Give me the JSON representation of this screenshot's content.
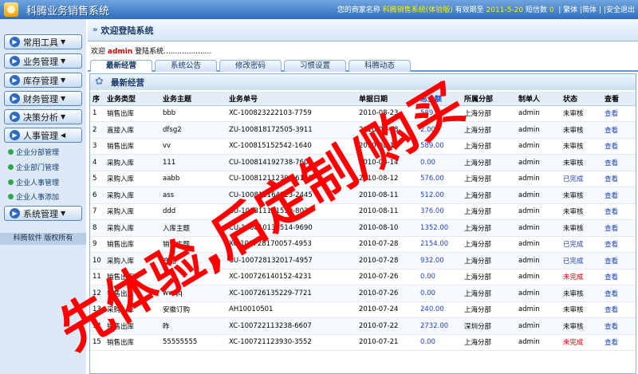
{
  "app": {
    "title": "科腾业务销售系统"
  },
  "topbar": {
    "shop_label": "您的商家名称",
    "shop_name": "科腾销售系统(体验版)",
    "valid_label": "有效期至",
    "valid_date": "2011-5-20",
    "sms_label": "短信数",
    "sms_count": "0",
    "links": [
      "繁体",
      "简体",
      "安全退出"
    ]
  },
  "sidebar": {
    "menus": [
      "常用工具",
      "业务管理",
      "库存管理",
      "财务管理",
      "决策分析",
      "人事管理",
      "系统管理"
    ],
    "hr_items": [
      "企业分部管理",
      "企业部门管理",
      "企业人事管理",
      "企业人事添加"
    ],
    "footer": "科腾软件 版权所有"
  },
  "main": {
    "header": "欢迎登陆系统",
    "welcome_prefix": "欢迎",
    "user": "admin",
    "welcome_suffix": "登陆系统.....................",
    "tabs": [
      "最新经营",
      "系统公告",
      "修改密码",
      "习惯设置",
      "科腾动态"
    ],
    "panel_title": "最新经营"
  },
  "table": {
    "columns": [
      "序",
      "业务类型",
      "业务主题",
      "业务单号",
      "单据日期",
      "总金额",
      "所属分部",
      "制单人",
      "状态",
      "查看"
    ],
    "rows": [
      [
        "1",
        "销售出库",
        "bbb",
        "XC-100823222103-7759",
        "2010-08-23",
        "589.00",
        "上海分部",
        "admin",
        "未审核",
        "查看"
      ],
      [
        "2",
        "直接入库",
        "dfsg2",
        "ZU-100818172505-3911",
        "2010-08-18",
        "2.00",
        "上海分部",
        "admin",
        "未审核",
        "查看"
      ],
      [
        "3",
        "销售出库",
        "vv",
        "XC-100815152542-1640",
        "2010-08-15",
        "589.00",
        "上海分部",
        "admin",
        "未审核",
        "查看"
      ],
      [
        "4",
        "采购入库",
        "111",
        "CU-100814192738-7601",
        "2010-08-14",
        "0.00",
        "上海分部",
        "admin",
        "未审核",
        "查看"
      ],
      [
        "5",
        "采购入库",
        "aabb",
        "CU-100812112308-6191",
        "2010-08-12",
        "576.00",
        "上海分部",
        "admin",
        "已完成",
        "查看"
      ],
      [
        "6",
        "采购入库",
        "ass",
        "CU-100811164123-2445",
        "2010-08-11",
        "512.00",
        "上海分部",
        "admin",
        "未审核",
        "查看"
      ],
      [
        "7",
        "采购入库",
        "ddd",
        "CU-100811111530-8020",
        "2010-08-11",
        "376.00",
        "上海分部",
        "admin",
        "未审核",
        "查看"
      ],
      [
        "8",
        "采购入库",
        "入库主题",
        "CU-100810134514-9690",
        "2010-08-10",
        "1352.00",
        "上海分部",
        "admin",
        "未审核",
        "查看"
      ],
      [
        "9",
        "销售出库",
        "销售主题",
        "XC-100728170057-4953",
        "2010-07-28",
        "2154.00",
        "上海分部",
        "admin",
        "已完成",
        "查看"
      ],
      [
        "10",
        "采购入库",
        "产品",
        "CU-100728132017-4957",
        "2010-07-28",
        "932.00",
        "上海分部",
        "admin",
        "已完成",
        "查看"
      ],
      [
        "11",
        "销售出库",
        "",
        "XC-100726140152-4231",
        "2010-07-26",
        "0.00",
        "上海分部",
        "admin",
        "未完成",
        "查看"
      ],
      [
        "12",
        "销售出库",
        "wwqq",
        "XC-100726135229-7721",
        "2010-07-26",
        "0.00",
        "上海分部",
        "admin",
        "未审核",
        "查看"
      ],
      [
        "13",
        "采购入库",
        "安徽订购",
        "AH10010501",
        "2010-07-24",
        "240.00",
        "上海分部",
        "admin",
        "未审核",
        "查看"
      ],
      [
        "14",
        "销售出库",
        "昨",
        "XC-100722113238-6607",
        "2010-07-22",
        "2732.00",
        "深圳分部",
        "admin",
        "未审核",
        "查看"
      ],
      [
        "15",
        "销售出库",
        "55555555",
        "XC-100721123930-3552",
        "2010-07-21",
        "0.00",
        "上海分部",
        "admin",
        "未完成",
        "查看"
      ]
    ]
  },
  "watermark": {
    "text": "先体验,后定制/购买",
    "color": "#ff0000"
  }
}
